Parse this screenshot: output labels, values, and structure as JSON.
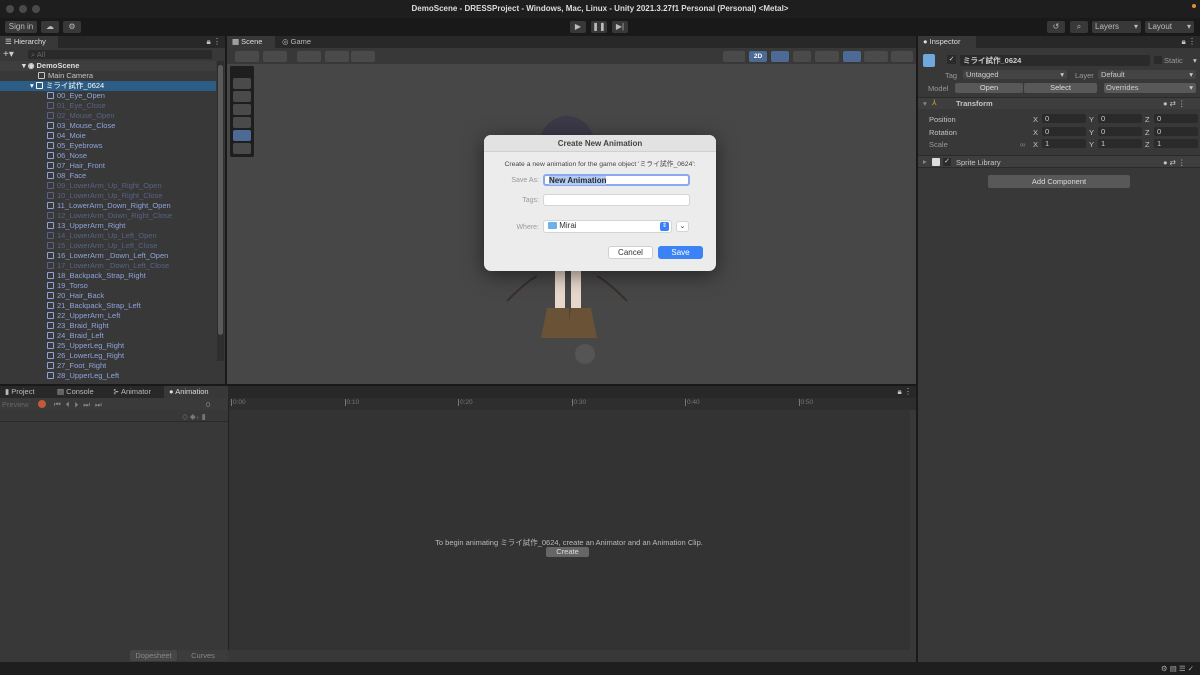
{
  "window": {
    "title": "DemoScene - DRESSProject - Windows, Mac, Linux - Unity 2021.3.27f1 Personal (Personal) <Metal>"
  },
  "toolbar": {
    "sign_in": "Sign in",
    "layers": "Layers",
    "layout": "Layout"
  },
  "hierarchy": {
    "tab": "Hierarchy",
    "search_placeholder": "All",
    "scene": "DemoScene",
    "items": [
      {
        "label": "Main Camera",
        "state": "normal",
        "indent": 1
      },
      {
        "label": "ミライ試作_0624",
        "state": "selected",
        "indent": 1
      },
      {
        "label": "00_Eye_Open",
        "state": "normal",
        "indent": 2
      },
      {
        "label": "01_Eye_Close",
        "state": "disabled",
        "indent": 2
      },
      {
        "label": "02_Mouse_Open",
        "state": "disabled",
        "indent": 2
      },
      {
        "label": "03_Mouse_Close",
        "state": "normal",
        "indent": 2
      },
      {
        "label": "04_Moie",
        "state": "normal",
        "indent": 2
      },
      {
        "label": "05_Eyebrows",
        "state": "normal",
        "indent": 2
      },
      {
        "label": "06_Nose",
        "state": "normal",
        "indent": 2
      },
      {
        "label": "07_Hair_Front",
        "state": "normal",
        "indent": 2
      },
      {
        "label": "08_Face",
        "state": "normal",
        "indent": 2
      },
      {
        "label": "09_LowerArm_Up_Right_Open",
        "state": "disabled",
        "indent": 2
      },
      {
        "label": "10_LowerArm_Up_Right_Close",
        "state": "disabled",
        "indent": 2
      },
      {
        "label": "11_LowerArm_Down_Right_Open",
        "state": "normal",
        "indent": 2
      },
      {
        "label": "12_LowerArm_Down_Right_Close",
        "state": "disabled",
        "indent": 2
      },
      {
        "label": "13_UpperArm_Right",
        "state": "normal",
        "indent": 2
      },
      {
        "label": "14_LowerArm_Up_Left_Open",
        "state": "disabled",
        "indent": 2
      },
      {
        "label": "15_LowerArm_Up_Left_Close",
        "state": "disabled",
        "indent": 2
      },
      {
        "label": "16_LowerArm _Down_Left_Open",
        "state": "normal",
        "indent": 2
      },
      {
        "label": "17_LowerArm _Down_Left_Close",
        "state": "disabled",
        "indent": 2
      },
      {
        "label": "18_Backpack_Strap_Right",
        "state": "normal",
        "indent": 2
      },
      {
        "label": "19_Torso",
        "state": "normal",
        "indent": 2
      },
      {
        "label": "20_Hair_Back",
        "state": "normal",
        "indent": 2
      },
      {
        "label": "21_Backpack_Strap_Left",
        "state": "normal",
        "indent": 2
      },
      {
        "label": "22_UpperArm_Left",
        "state": "normal",
        "indent": 2
      },
      {
        "label": "23_Braid_Right",
        "state": "normal",
        "indent": 2
      },
      {
        "label": "24_Braid_Left",
        "state": "normal",
        "indent": 2
      },
      {
        "label": "25_UpperLeg_Right",
        "state": "normal",
        "indent": 2
      },
      {
        "label": "26_LowerLeg_Right",
        "state": "normal",
        "indent": 2
      },
      {
        "label": "27_Foot_Right",
        "state": "normal",
        "indent": 2
      },
      {
        "label": "28_UpperLeg_Left",
        "state": "normal",
        "indent": 2
      }
    ]
  },
  "scene": {
    "tabs": [
      "Scene",
      "Game"
    ],
    "mode_2d": "2D"
  },
  "dialog": {
    "title": "Create New Animation",
    "description": "Create a new animation for the game object 'ミライ試作_0624':",
    "save_as_label": "Save As:",
    "save_as_value": "New Animation",
    "tags_label": "Tags:",
    "tags_value": "",
    "where_label": "Where:",
    "where_value": "Mirai",
    "cancel": "Cancel",
    "save": "Save",
    "accent": "#3b82f6"
  },
  "inspector": {
    "tab": "Inspector",
    "object_name": "ミライ試作_0624",
    "static_label": "Static",
    "tag_label": "Tag",
    "tag_value": "Untagged",
    "layer_label": "Layer",
    "layer_value": "Default",
    "model_label": "Model",
    "open": "Open",
    "select": "Select",
    "overrides": "Overrides",
    "transform": {
      "title": "Transform",
      "rows": [
        {
          "label": "Position",
          "x": "0",
          "y": "0",
          "z": "0"
        },
        {
          "label": "Rotation",
          "x": "0",
          "y": "0",
          "z": "0"
        },
        {
          "label": "Scale",
          "x": "1",
          "y": "1",
          "z": "1"
        }
      ]
    },
    "axes": [
      "X",
      "Y",
      "Z"
    ],
    "sprite_library": "Sprite Library",
    "add_component": "Add Component"
  },
  "bottom": {
    "tabs": [
      "Project",
      "Console",
      "Animator",
      "Animation"
    ],
    "active_tab": "Animation",
    "preview": "Preview",
    "frame": "0",
    "ruler": [
      "0:00",
      "0:10",
      "0:20",
      "0:30",
      "0:40",
      "0:50"
    ],
    "message": "To begin animating ミライ試作_0624, create an Animator and an Animation Clip.",
    "create": "Create",
    "dopesheet": "Dopesheet",
    "curves": "Curves"
  }
}
